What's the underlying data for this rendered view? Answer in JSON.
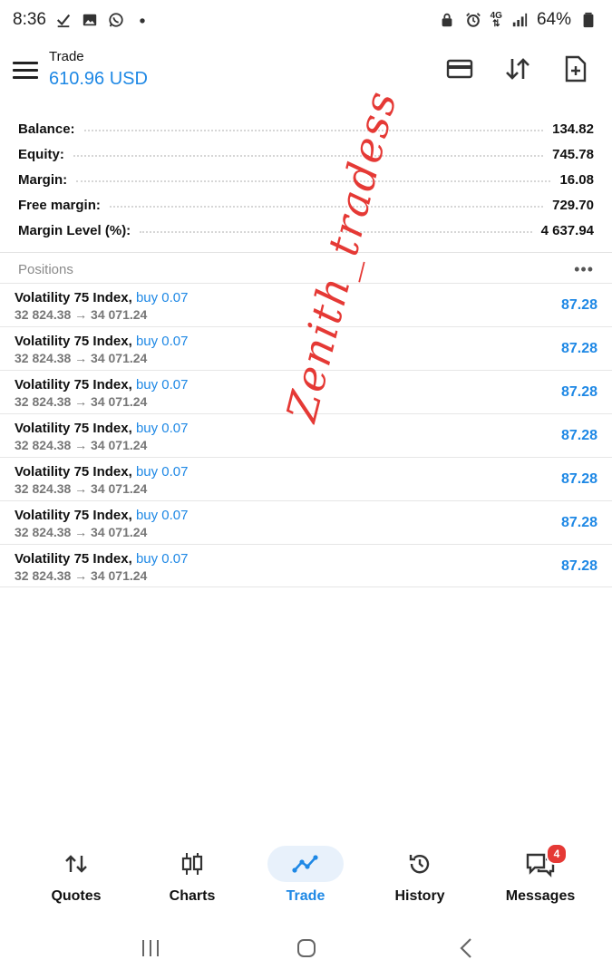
{
  "status_bar": {
    "time": "8:36",
    "network": "4G",
    "battery": "64%",
    "icons": [
      "check-icon",
      "image-icon",
      "whatsapp-icon",
      "dot-icon",
      "lock-icon",
      "alarm-icon",
      "signal-icon",
      "battery-icon"
    ]
  },
  "header": {
    "title": "Trade",
    "balance": "610.96 USD",
    "actions": [
      "card-icon",
      "sort-arrows-icon",
      "new-order-icon"
    ]
  },
  "summary": [
    {
      "label": "Balance:",
      "value": "134.82"
    },
    {
      "label": "Equity:",
      "value": "745.78"
    },
    {
      "label": "Margin:",
      "value": "16.08"
    },
    {
      "label": "Free margin:",
      "value": "729.70"
    },
    {
      "label": "Margin Level (%):",
      "value": "4 637.94"
    }
  ],
  "positions": {
    "title": "Positions",
    "more": "•••",
    "items": [
      {
        "symbol": "Volatility 75 Index,",
        "side": "buy 0.07",
        "prices": "32 824.38 → 34 071.24",
        "profit": "87.28"
      },
      {
        "symbol": "Volatility 75 Index,",
        "side": "buy 0.07",
        "prices": "32 824.38 → 34 071.24",
        "profit": "87.28"
      },
      {
        "symbol": "Volatility 75 Index,",
        "side": "buy 0.07",
        "prices": "32 824.38 → 34 071.24",
        "profit": "87.28"
      },
      {
        "symbol": "Volatility 75 Index,",
        "side": "buy 0.07",
        "prices": "32 824.38 → 34 071.24",
        "profit": "87.28"
      },
      {
        "symbol": "Volatility 75 Index,",
        "side": "buy 0.07",
        "prices": "32 824.38 → 34 071.24",
        "profit": "87.28"
      },
      {
        "symbol": "Volatility 75 Index,",
        "side": "buy 0.07",
        "prices": "32 824.38 → 34 071.24",
        "profit": "87.28"
      },
      {
        "symbol": "Volatility 75 Index,",
        "side": "buy 0.07",
        "prices": "32 824.38 → 34 071.24",
        "profit": "87.28"
      }
    ]
  },
  "watermark": "Zenith_tradess",
  "bottom_nav": [
    {
      "label": "Quotes",
      "icon": "quotes-arrows-icon"
    },
    {
      "label": "Charts",
      "icon": "candlestick-icon"
    },
    {
      "label": "Trade",
      "icon": "trend-line-icon",
      "active": true
    },
    {
      "label": "History",
      "icon": "history-clock-icon"
    },
    {
      "label": "Messages",
      "icon": "chat-icon",
      "badge": "4"
    }
  ],
  "colors": {
    "accent": "#1e88e5",
    "watermark": "#e53935",
    "badge": "#e53935",
    "muted": "#8a8a8a"
  }
}
